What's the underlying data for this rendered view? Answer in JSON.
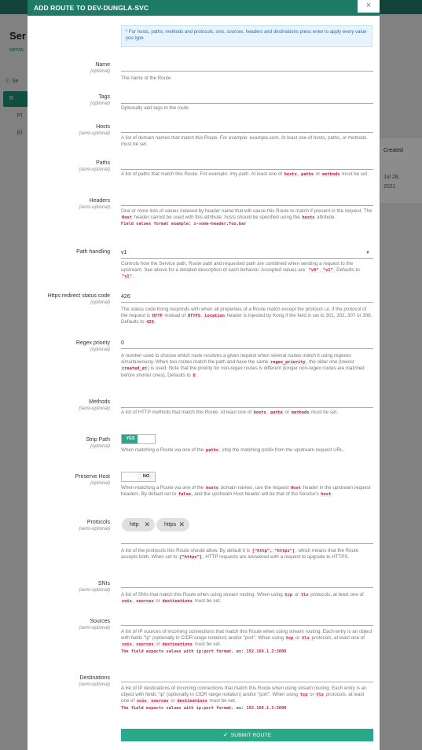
{
  "background": {
    "title": "Ser",
    "subtitle": "servic",
    "nav": [
      "Se",
      "R",
      "Pl",
      "El"
    ],
    "table": {
      "header": "Created",
      "date": "Jul 28,",
      "year": "2021"
    }
  },
  "modal": {
    "title": "ADD ROUTE TO DEV-DUNGLA-SVC",
    "close_icon": "×",
    "info": "* For hosts, paths, methods and protocols, snis, sources, headers and destinations press enter to apply every value you type"
  },
  "fields": {
    "name": {
      "label": "Name",
      "qualifier": "(optional)",
      "value": "",
      "help": "The name of the Route"
    },
    "tags": {
      "label": "Tags",
      "qualifier": "(optional)",
      "value": "",
      "help": "Optionally add tags to the route"
    },
    "hosts": {
      "label": "Hosts",
      "qualifier": "(semi-optional)",
      "value": "",
      "help": "A list of domain names that match this Route. For example: example.com. At least one of hosts, paths, or methods must be set."
    },
    "paths": {
      "label": "Paths",
      "qualifier": "(semi-optional)",
      "value": "",
      "help_a": "A list of paths that match this Route. For example: /my-path. At least one of",
      "code1": "hosts",
      "sep1": ",",
      "code2": "paths",
      "or": "or",
      "code3": "methods",
      "help_b": "must be set."
    },
    "headers": {
      "label": "Headers",
      "qualifier": "(semi-optional)",
      "value": "",
      "help_a": "One or more lists of values indexed by header name that will cause this Route to match if present in the request. The",
      "code1": "Host",
      "help_b": "header cannot be used with this attribute: hosts should be specified using the",
      "code2": "hosts",
      "help_c": "attribute.",
      "format": "Field values format example: x-some-header:foo,bar"
    },
    "path_handling": {
      "label": "Path handling",
      "value": "v1",
      "help_a": "Controls how the Service path, Route path and requested path are combined when sending a request to the upstream. See above for a detailed description of each behavior. Accepted values are:",
      "code1": "\"v0\"",
      "sep": ",",
      "code2": "\"v1\"",
      "help_b": ". Defaults to",
      "code3": "\"v1\"",
      "end": "."
    },
    "https_redirect": {
      "label": "Https redirect status code",
      "qualifier": "(optional)",
      "value": "426",
      "help_a": "The status code Kong responds with when all properties of a Route match except the protocol i.e. if the protocol of the request is",
      "code1": "HTTP",
      "help_b": "instead of",
      "code2": "HTTPS",
      "sep": ".",
      "code3": "Location",
      "help_c": "header is injected by Kong if the field is set to 301, 302, 307 or 308. Defaults to",
      "code4": "426",
      "end": "."
    },
    "regex_priority": {
      "label": "Regex priority",
      "qualifier": "(optional)",
      "value": "0",
      "help_a": "A number used to choose which route resolves a given request when several routes match it using regexes simultaneously. When two routes match the path and have the same",
      "code1": "regex_priority",
      "help_b": ", the older one (lowest",
      "code2": "created_at",
      "help_c": ") is used. Note that the priority for non-regex routes is different (longer non-regex routes are matched before shorter ones). Defaults to",
      "code3": "0",
      "end": "."
    },
    "methods": {
      "label": "Methods",
      "qualifier": "(semi-optional)",
      "value": "",
      "help_a": "A list of HTTP methods that match this Route. At least one of",
      "code1": "hosts",
      "sep1": ",",
      "code2": "paths",
      "or": "or",
      "code3": "methods",
      "help_b": "must be set."
    },
    "strip_path": {
      "label": "Strip Path",
      "qualifier": "(optional)",
      "state": "YES",
      "help_a": "When matching a Route via one of the",
      "code1": "paths",
      "help_b": ", strip the matching prefix from the upstream request URL."
    },
    "preserve_host": {
      "label": "Preserve Host",
      "qualifier": "(optional)",
      "state": "NO",
      "help_a": "When matching a Route via one of the",
      "code1": "hosts",
      "help_b": "domain names, use the request",
      "code2": "Host",
      "help_c": "header in the upstream request headers. By default set to",
      "code3": "false",
      "help_d": ", and the upstream Host header will be that of the Service's",
      "code4": "host",
      "end": "."
    },
    "protocols": {
      "label": "Protocols",
      "qualifier": "(semi-optional)",
      "chips": [
        "http",
        "https"
      ],
      "help_a": "A list of the protocols this Route should allow. By default it is",
      "code1": "[\"http\", \"https\"]",
      "help_b": ", which means that the Route accepts both. When set to",
      "code2": "[\"https\"]",
      "help_c": ", HTTP requests are answered with a request to upgrade to HTTPS."
    },
    "snis": {
      "label": "SNIs",
      "qualifier": "(semi-optional)",
      "value": "",
      "help_a": "A list of SNIs that match this Route when using stream routing. When using",
      "code1": "tcp",
      "or": "or",
      "code2": "tls",
      "help_b": "protocols, at least one of",
      "code3": "snis",
      "sep1": ",",
      "code4": "sources",
      "or2": "or",
      "code5": "destinations",
      "help_c": "must be set."
    },
    "sources": {
      "label": "Sources",
      "qualifier": "(semi-optional)",
      "value": "",
      "help_a": "A list of IP sources of incoming connections that match this Route when using stream routing. Each entry is an object with fields \"ip\" (optionally in CIDR range notation) and/or \"port\". When using",
      "code1": "tcp",
      "or": "or",
      "code2": "tls",
      "help_b": "protocols, at least one of",
      "code3": "snis",
      "sep1": ",",
      "code4": "sources",
      "or2": "or",
      "code5": "destinations",
      "help_c": "must be set.",
      "format": "The field expects values with ip:port format. ex: 192.168.1.2:3000"
    },
    "destinations": {
      "label": "Destinations",
      "qualifier": "(semi-optional)",
      "value": "",
      "help_a": "A list of IP destinations of incoming connections that match this Route when using stream routing. Each entry is an object with fields \"ip\" (optionally in CIDR range notation) and/or \"port\". When using",
      "code1": "tcp",
      "or": "or",
      "code2": "tls",
      "help_b": "protocols, at least one of",
      "code3": "snis",
      "sep1": ",",
      "code4": "sources",
      "or2": "or",
      "code5": "destinations",
      "help_c": "must be set.",
      "format": "The field expects values with ip:port format. ex: 192.168.1.2:3000"
    }
  },
  "submit": {
    "label": "SUBMIT ROUTE",
    "icon": "✓"
  },
  "colors": {
    "accent": "#28a989",
    "header": "#1e7b68",
    "code": "#c7254e"
  }
}
